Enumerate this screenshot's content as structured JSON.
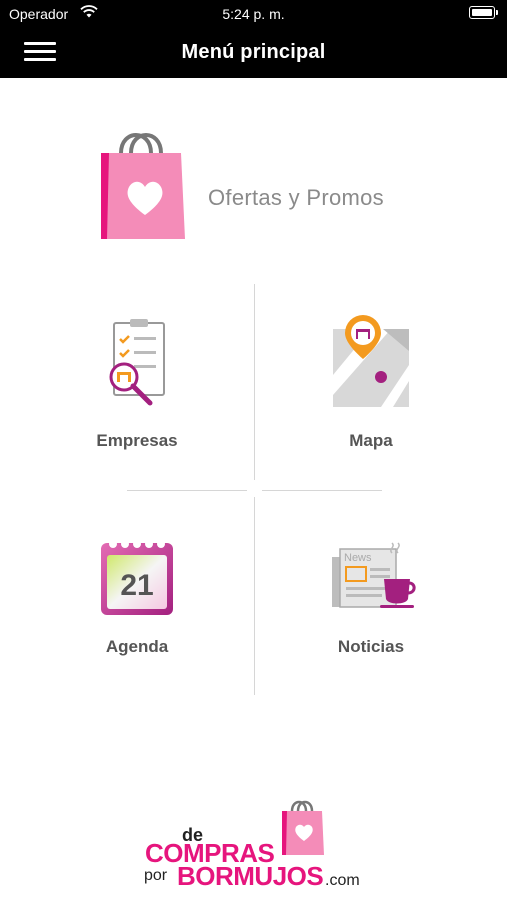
{
  "status_bar": {
    "carrier": "Operador",
    "time": "5:24 p. m."
  },
  "nav_bar": {
    "title": "Menú principal",
    "menu_icon": "hamburger-menu-icon"
  },
  "promo_banner": {
    "label": "Ofertas y Promos",
    "icon": "shopping-bag-heart-icon"
  },
  "menu_tiles": [
    {
      "label": "Empresas",
      "icon": "business-checklist-icon"
    },
    {
      "label": "Mapa",
      "icon": "map-pin-icon"
    },
    {
      "label": "Agenda",
      "icon": "calendar-icon",
      "calendar_day": "21"
    },
    {
      "label": "Noticias",
      "icon": "newspaper-coffee-icon",
      "newspaper_text": "News"
    }
  ],
  "footer": {
    "logo_line1": "de",
    "logo_line2": "COMPRAS",
    "logo_line3": "por",
    "logo_line4": "BORMUJOS",
    "logo_line5": ".com"
  },
  "colors": {
    "brand_pink": "#e6157d",
    "bag_pink": "#f48cb8",
    "header_bg": "#000000",
    "label_grey": "#555555"
  }
}
